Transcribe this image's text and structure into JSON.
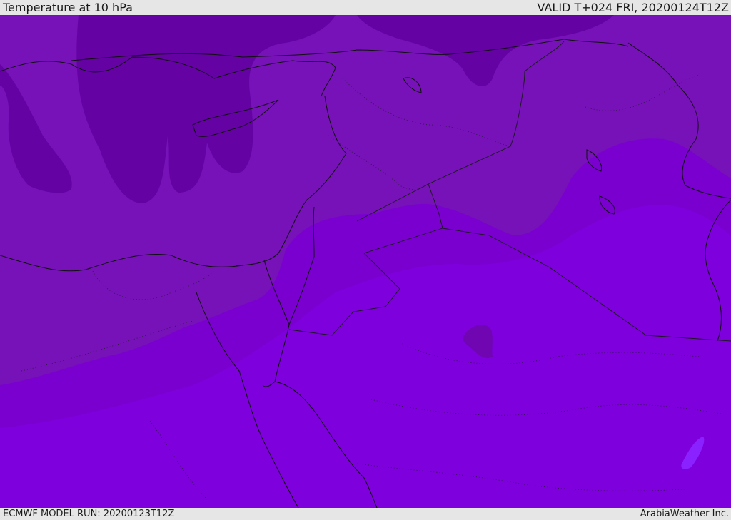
{
  "header": {
    "title": "Temperature at 10 hPa",
    "valid_time": "VALID T+024 FRI, 20200124T12Z"
  },
  "footer": {
    "model_run": "ECMWF MODEL RUN: 20200123T12Z",
    "credit": "ArabiaWeather Inc."
  },
  "colors": {
    "band_coldest": "#6100a0",
    "band_cold": "#6b08a8",
    "band_mid": "#7612b8",
    "band_warm": "#7a00d0",
    "band_warmer": "#7e00dc",
    "band_hot_patch": "#8a22ff",
    "coastline": "#111111",
    "header_bg": "#e6e6e6"
  }
}
